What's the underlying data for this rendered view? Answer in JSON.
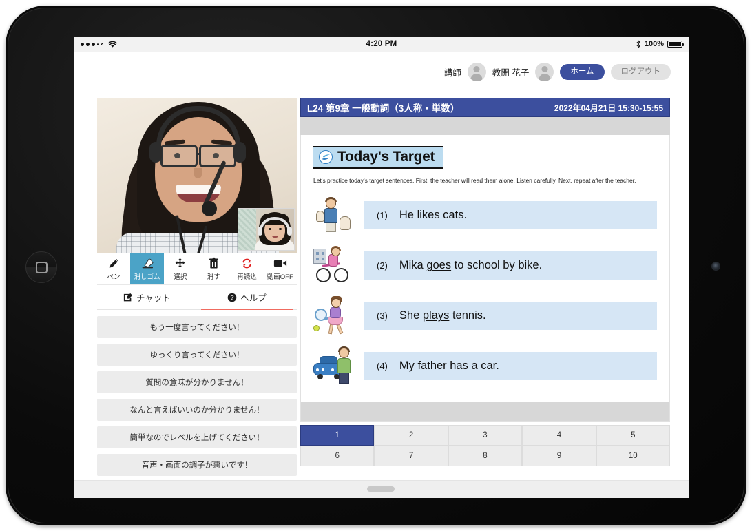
{
  "status_bar": {
    "signal_filled": 3,
    "signal_empty": 2,
    "wifi_icon": "wifi-icon",
    "time": "4:20 PM",
    "bluetooth_icon": "bluetooth-icon",
    "battery_percent": "100%"
  },
  "header": {
    "role_label": "講師",
    "user_name": "教開 花子",
    "home_label": "ホーム",
    "logout_label": "ログアウト",
    "accent_color": "#3c4f9e"
  },
  "toolbar": {
    "tools": [
      {
        "label": "ペン",
        "icon": "pen-icon",
        "active": false
      },
      {
        "label": "消しゴム",
        "icon": "eraser-icon",
        "active": true
      },
      {
        "label": "選択",
        "icon": "move-select-icon",
        "active": false
      },
      {
        "label": "消す",
        "icon": "trash-icon",
        "active": false
      },
      {
        "label": "再読込",
        "icon": "reload-icon",
        "active": false
      },
      {
        "label": "動画OFF",
        "icon": "video-off-icon",
        "active": false
      }
    ],
    "active_color": "#4ba3c7",
    "reload_icon_color": "#e02020"
  },
  "tabs": {
    "items": [
      {
        "label": "チャット",
        "icon": "chat-edit-icon",
        "active": false
      },
      {
        "label": "ヘルプ",
        "icon": "help-question-icon",
        "active": true
      }
    ],
    "active_underline_color": "#f06b60"
  },
  "help_phrases": [
    "もう一度言ってください！",
    "ゆっくり言ってください！",
    "質問の意味が分かりません！",
    "なんと言えばいいのか分かりません！",
    "簡単なのでレベルを上げてください！",
    "音声・画面の調子が悪いです！"
  ],
  "lesson": {
    "title": "L24 第9章 一般動詞（3人称・単数）",
    "datetime": "2022年04月21日 15:30-15:55"
  },
  "worksheet": {
    "section_title": "Today's Target",
    "logo_icon": "swoosh-logo-icon",
    "description": "Let's practice today's target sentences.  First, the teacher will read them alone.  Listen carefully.  Next,  repeat after the teacher.",
    "sentences": [
      {
        "number": "(1)",
        "before": "He ",
        "verb": "likes",
        "after": " cats.",
        "illustration": "boy-with-cats-icon"
      },
      {
        "number": "(2)",
        "before": "Mika ",
        "verb": "goes",
        "after": " to school by bike.",
        "illustration": "girl-on-bike-icon"
      },
      {
        "number": "(3)",
        "before": "She ",
        "verb": "plays",
        "after": " tennis.",
        "illustration": "girl-playing-tennis-icon"
      },
      {
        "number": "(4)",
        "before": "My father ",
        "verb": "has",
        "after": " a car.",
        "illustration": "man-with-car-icon"
      }
    ],
    "highlight_color": "#d6e6f5",
    "heading_bg_color": "#bcdcf0"
  },
  "pager": {
    "pages": [
      "1",
      "2",
      "3",
      "4",
      "5",
      "6",
      "7",
      "8",
      "9",
      "10"
    ],
    "active": "1"
  },
  "video": {
    "main_participant": "teacher-video-feed",
    "pip_participant": "student-video-feed"
  }
}
